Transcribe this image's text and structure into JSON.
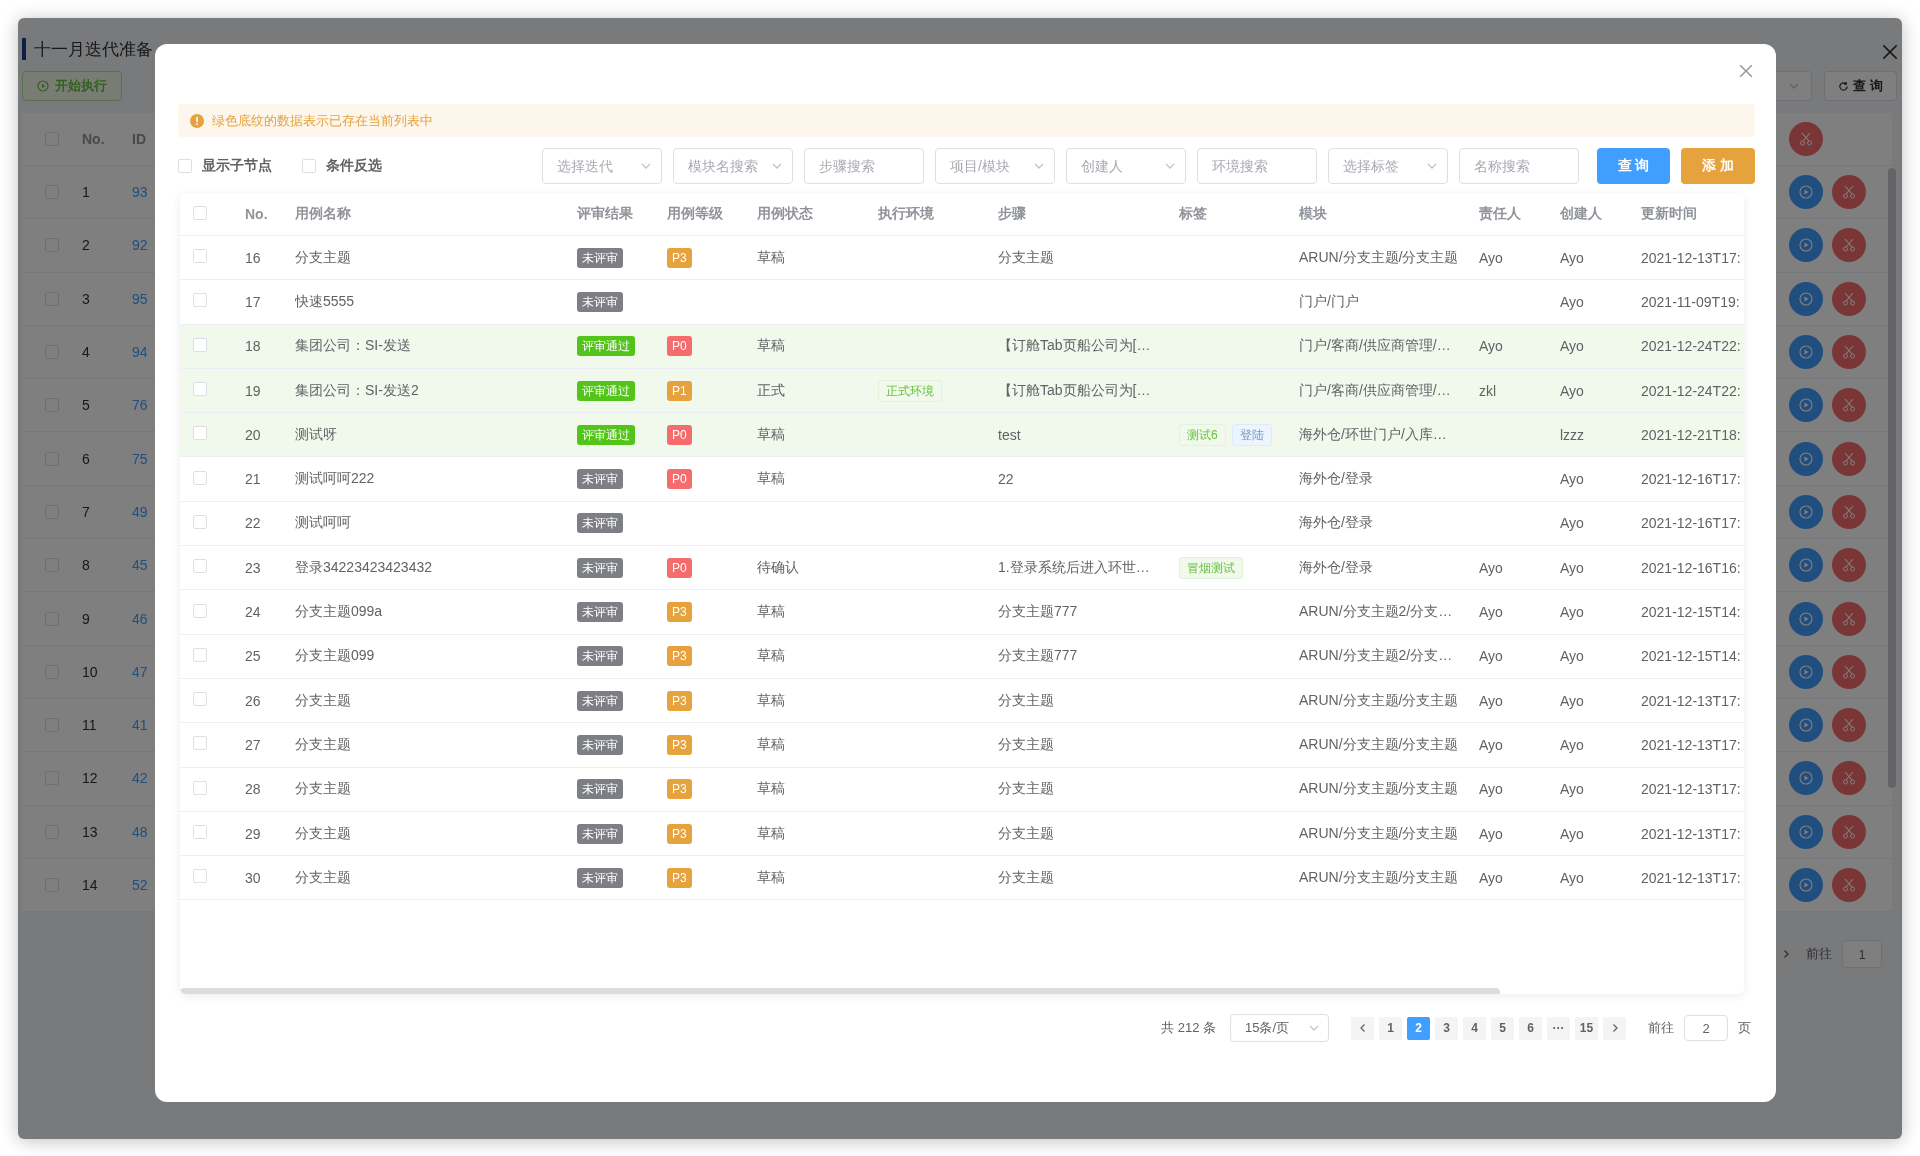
{
  "page": {
    "title": "十一月迭代准备",
    "start_button": "开始执行",
    "query_button": "查 询",
    "table": {
      "columns": [
        "No.",
        "ID"
      ],
      "rows": [
        {
          "no": "1",
          "id": "93",
          "checked": false
        },
        {
          "no": "2",
          "id": "92",
          "checked": false
        },
        {
          "no": "3",
          "id": "95",
          "checked": false
        },
        {
          "no": "4",
          "id": "94",
          "checked": false
        },
        {
          "no": "5",
          "id": "76",
          "checked": false
        },
        {
          "no": "6",
          "id": "75",
          "checked": false
        },
        {
          "no": "7",
          "id": "49",
          "checked": false
        },
        {
          "no": "8",
          "id": "45",
          "checked": false
        },
        {
          "no": "9",
          "id": "46",
          "checked": false
        },
        {
          "no": "10",
          "id": "47",
          "checked": false
        },
        {
          "no": "11",
          "id": "41",
          "checked": false
        },
        {
          "no": "12",
          "id": "42",
          "checked": false
        },
        {
          "no": "13",
          "id": "48",
          "checked": false
        },
        {
          "no": "14",
          "id": "52",
          "checked": false
        }
      ],
      "header_checked": false
    },
    "pagination": {
      "goto_label": "前往",
      "goto_value": "1"
    }
  },
  "dialog": {
    "alert": "绿色底纹的数据表示已存在当前列表中",
    "options": [
      {
        "label": "显示子节点",
        "checked": false
      },
      {
        "label": "条件反选",
        "checked": false
      }
    ],
    "filters": [
      {
        "kind": "select",
        "placeholder": "选择迭代"
      },
      {
        "kind": "select",
        "placeholder": "模块名搜索"
      },
      {
        "kind": "input",
        "placeholder": "步骤搜索"
      },
      {
        "kind": "select",
        "placeholder": "项目/模块"
      },
      {
        "kind": "select",
        "placeholder": "创建人"
      },
      {
        "kind": "input",
        "placeholder": "环境搜索"
      },
      {
        "kind": "select",
        "placeholder": "选择标签"
      },
      {
        "kind": "input",
        "placeholder": "名称搜索"
      }
    ],
    "buttons": [
      {
        "kind": "primary",
        "label": "查 询"
      },
      {
        "kind": "warning",
        "label": "添 加"
      }
    ],
    "table": {
      "header_checked": false,
      "columns": [
        "No.",
        "用例名称",
        "评审结果",
        "用例等级",
        "用例状态",
        "执行环境",
        "步骤",
        "标签",
        "模块",
        "责任人",
        "创建人",
        "更新时间"
      ],
      "rows": [
        {
          "no": "16",
          "name": "分支主题",
          "review": {
            "label": "未评审",
            "passed": false
          },
          "priority": {
            "label": "P3",
            "kind": "warning"
          },
          "status": "草稿",
          "steps": "分支主题",
          "tags": [],
          "module": "ARUN/分支主题/分支主题",
          "owner": "Ayo",
          "creator": "Ayo",
          "updated": "2021-12-13T17:",
          "existing": false,
          "checked": false
        },
        {
          "no": "17",
          "name": "快速5555",
          "review": {
            "label": "未评审",
            "passed": false
          },
          "tags": [],
          "module": "门户/门户",
          "creator": "Ayo",
          "updated": "2021-11-09T19:",
          "existing": false,
          "checked": false
        },
        {
          "no": "18",
          "name": "集团公司：SI-发送",
          "review": {
            "label": "评审通过",
            "passed": true
          },
          "priority": {
            "label": "P0",
            "kind": "danger"
          },
          "status": "草稿",
          "steps": "【订舱Tab页船公司为[…",
          "tags": [],
          "module": "门户/客商/供应商管理/…",
          "owner": "Ayo",
          "creator": "Ayo",
          "updated": "2021-12-24T22:",
          "existing": true,
          "checked": false
        },
        {
          "no": "19",
          "name": "集团公司：SI-发送2",
          "review": {
            "label": "评审通过",
            "passed": true
          },
          "priority": {
            "label": "P1",
            "kind": "warning"
          },
          "status": "正式",
          "env": {
            "label": "正式环境",
            "kind": "success"
          },
          "steps": "【订舱Tab页船公司为[…",
          "tags": [],
          "module": "门户/客商/供应商管理/…",
          "owner": "zkl",
          "creator": "Ayo",
          "updated": "2021-12-24T22:",
          "existing": true,
          "checked": false
        },
        {
          "no": "20",
          "name": "测试呀",
          "review": {
            "label": "评审通过",
            "passed": true
          },
          "priority": {
            "label": "P0",
            "kind": "danger"
          },
          "status": "草稿",
          "steps": "test",
          "tags": [
            {
              "label": "测试6",
              "kind": "success"
            },
            {
              "label": "登陆",
              "kind": "primary"
            }
          ],
          "module": "海外仓/环世门户/入库…",
          "creator": "lzzz",
          "updated": "2021-12-21T18:",
          "existing": true,
          "checked": false
        },
        {
          "no": "21",
          "name": "测试呵呵222",
          "review": {
            "label": "未评审",
            "passed": false
          },
          "priority": {
            "label": "P0",
            "kind": "danger"
          },
          "status": "草稿",
          "steps": "22",
          "tags": [],
          "module": "海外仓/登录",
          "creator": "Ayo",
          "updated": "2021-12-16T17:",
          "existing": false,
          "checked": false
        },
        {
          "no": "22",
          "name": "测试呵呵",
          "review": {
            "label": "未评审",
            "passed": false
          },
          "tags": [],
          "module": "海外仓/登录",
          "creator": "Ayo",
          "updated": "2021-12-16T17:",
          "existing": false,
          "checked": false
        },
        {
          "no": "23",
          "name": "登录34223423423432",
          "review": {
            "label": "未评审",
            "passed": false
          },
          "priority": {
            "label": "P0",
            "kind": "danger"
          },
          "status": "待确认",
          "steps": "1.登录系统后进入环世…",
          "tags": [
            {
              "label": "冒烟测试",
              "kind": "success"
            }
          ],
          "module": "海外仓/登录",
          "owner": "Ayo",
          "creator": "Ayo",
          "updated": "2021-12-16T16:",
          "existing": false,
          "checked": false
        },
        {
          "no": "24",
          "name": "分支主题099a",
          "review": {
            "label": "未评审",
            "passed": false
          },
          "priority": {
            "label": "P3",
            "kind": "warning"
          },
          "status": "草稿",
          "steps": "分支主题777",
          "tags": [],
          "module": "ARUN/分支主题2/分支…",
          "owner": "Ayo",
          "creator": "Ayo",
          "updated": "2021-12-15T14:",
          "existing": false,
          "checked": false
        },
        {
          "no": "25",
          "name": "分支主题099",
          "review": {
            "label": "未评审",
            "passed": false
          },
          "priority": {
            "label": "P3",
            "kind": "warning"
          },
          "status": "草稿",
          "steps": "分支主题777",
          "tags": [],
          "module": "ARUN/分支主题2/分支…",
          "owner": "Ayo",
          "creator": "Ayo",
          "updated": "2021-12-15T14:",
          "existing": false,
          "checked": false
        },
        {
          "no": "26",
          "name": "分支主题",
          "review": {
            "label": "未评审",
            "passed": false
          },
          "priority": {
            "label": "P3",
            "kind": "warning"
          },
          "status": "草稿",
          "steps": "分支主题",
          "tags": [],
          "module": "ARUN/分支主题/分支主题",
          "owner": "Ayo",
          "creator": "Ayo",
          "updated": "2021-12-13T17:",
          "existing": false,
          "checked": false
        },
        {
          "no": "27",
          "name": "分支主题",
          "review": {
            "label": "未评审",
            "passed": false
          },
          "priority": {
            "label": "P3",
            "kind": "warning"
          },
          "status": "草稿",
          "steps": "分支主题",
          "tags": [],
          "module": "ARUN/分支主题/分支主题",
          "owner": "Ayo",
          "creator": "Ayo",
          "updated": "2021-12-13T17:",
          "existing": false,
          "checked": false
        },
        {
          "no": "28",
          "name": "分支主题",
          "review": {
            "label": "未评审",
            "passed": false
          },
          "priority": {
            "label": "P3",
            "kind": "warning"
          },
          "status": "草稿",
          "steps": "分支主题",
          "tags": [],
          "module": "ARUN/分支主题/分支主题",
          "owner": "Ayo",
          "creator": "Ayo",
          "updated": "2021-12-13T17:",
          "existing": false,
          "checked": false
        },
        {
          "no": "29",
          "name": "分支主题",
          "review": {
            "label": "未评审",
            "passed": false
          },
          "priority": {
            "label": "P3",
            "kind": "warning"
          },
          "status": "草稿",
          "steps": "分支主题",
          "tags": [],
          "module": "ARUN/分支主题/分支主题",
          "owner": "Ayo",
          "creator": "Ayo",
          "updated": "2021-12-13T17:",
          "existing": false,
          "checked": false
        },
        {
          "no": "30",
          "name": "分支主题",
          "review": {
            "label": "未评审",
            "passed": false
          },
          "priority": {
            "label": "P3",
            "kind": "warning"
          },
          "status": "草稿",
          "steps": "分支主题",
          "tags": [],
          "module": "ARUN/分支主题/分支主题",
          "owner": "Ayo",
          "creator": "Ayo",
          "updated": "2021-12-13T17:",
          "existing": false,
          "checked": false
        }
      ]
    },
    "pagination": {
      "total": "共 212 条",
      "page_size": "15条/页",
      "pages": [
        {
          "label": "1",
          "selected": false
        },
        {
          "label": "2",
          "selected": true
        },
        {
          "label": "3",
          "selected": false
        },
        {
          "label": "4",
          "selected": false
        },
        {
          "label": "5",
          "selected": false
        },
        {
          "label": "6",
          "selected": false
        },
        {
          "label": "···",
          "selected": false
        },
        {
          "label": "15",
          "selected": false
        }
      ],
      "goto_label": "前往",
      "goto_value": "2",
      "page_unit": "页"
    }
  }
}
